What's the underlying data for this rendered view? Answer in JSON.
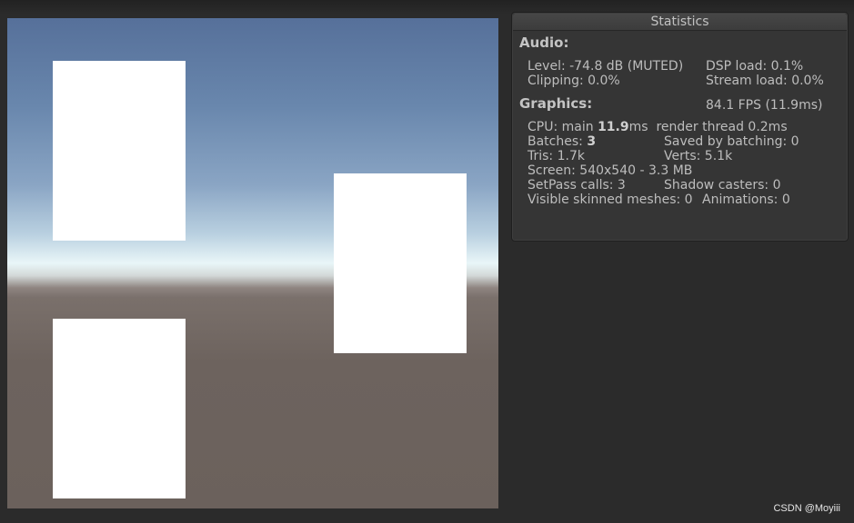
{
  "stats": {
    "title": "Statistics",
    "audio": {
      "heading": "Audio:",
      "level": "Level: -74.8 dB (MUTED)",
      "dsp_load": "DSP load: 0.1%",
      "clipping": "Clipping: 0.0%",
      "stream_load": "Stream load: 0.0%"
    },
    "graphics": {
      "heading": "Graphics:",
      "fps": "84.1 FPS (11.9ms)",
      "cpu_prefix": "CPU: main ",
      "cpu_main_ms": "11.9",
      "cpu_suffix": "ms  render thread 0.2ms",
      "batches_label": "Batches: ",
      "batches_value": "3",
      "saved_by_batching": "Saved by batching: 0",
      "tris": "Tris: 1.7k",
      "verts": "Verts: 5.1k",
      "screen": "Screen: 540x540 - 3.3 MB",
      "setpass": "SetPass calls: 3",
      "shadow_casters": "Shadow casters: 0",
      "visible_skinned": "Visible skinned meshes: 0",
      "animations": "Animations: 0"
    }
  },
  "watermark": "CSDN @Moyiii"
}
